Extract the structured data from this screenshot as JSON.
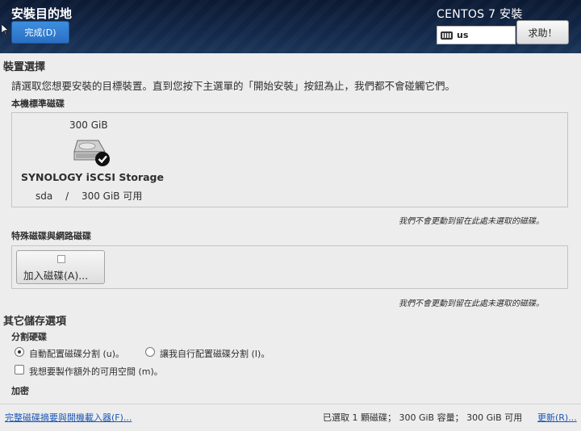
{
  "header": {
    "title": "安裝目的地",
    "done_button": "完成(D)",
    "product": "CENTOS 7 安裝",
    "keyboard_layout": "us",
    "help_button": "求助！"
  },
  "device_selection": {
    "heading": "裝置選擇",
    "instruction": "請選取您想要安裝的目標裝置。直到您按下主選單的「開始安裝」按鈕為止，我們都不會碰觸它們。",
    "local_disks": {
      "heading": "本機標準磁碟",
      "disks": [
        {
          "size": "300 GiB",
          "name": "SYNOLOGY iSCSI Storage",
          "device": "sda",
          "separator": "/",
          "free": "300 GiB 可用",
          "selected": true
        }
      ],
      "note": "我們不會更動到留在此處未選取的磁碟。"
    },
    "special_disks": {
      "heading": "特殊磁碟與網路磁碟",
      "add_button": "加入磁碟(A)...",
      "note": "我們不會更動到留在此處未選取的磁碟。"
    }
  },
  "other_storage": {
    "heading": "其它儲存選項",
    "partitioning": {
      "heading": "分割硬碟",
      "auto_label": "自動配置磁碟分割 (u)。",
      "manual_label": "讓我自行配置磁碟分割 (I)。",
      "selected": "auto",
      "extra_space_label": "我想要製作額外的可用空間 (m)。",
      "extra_space_checked": false
    },
    "encryption": {
      "heading": "加密"
    }
  },
  "footer": {
    "summary_link": "完整磁碟摘要與開機載入器(F)...",
    "status": "已選取 1 顆磁碟； 300 GiB 容量； 300 GiB 可用",
    "refresh_link": "更新(R)..."
  },
  "icons": {
    "keyboard": "keyboard-icon",
    "disk": "hard-disk-icon",
    "selected": "checkmark-badge-icon",
    "add": "disk-add-icon"
  },
  "colors": {
    "header_bg": "#13284a",
    "done_button": "#2a6fc2",
    "link": "#1c56b5",
    "page_bg": "#ededed"
  }
}
